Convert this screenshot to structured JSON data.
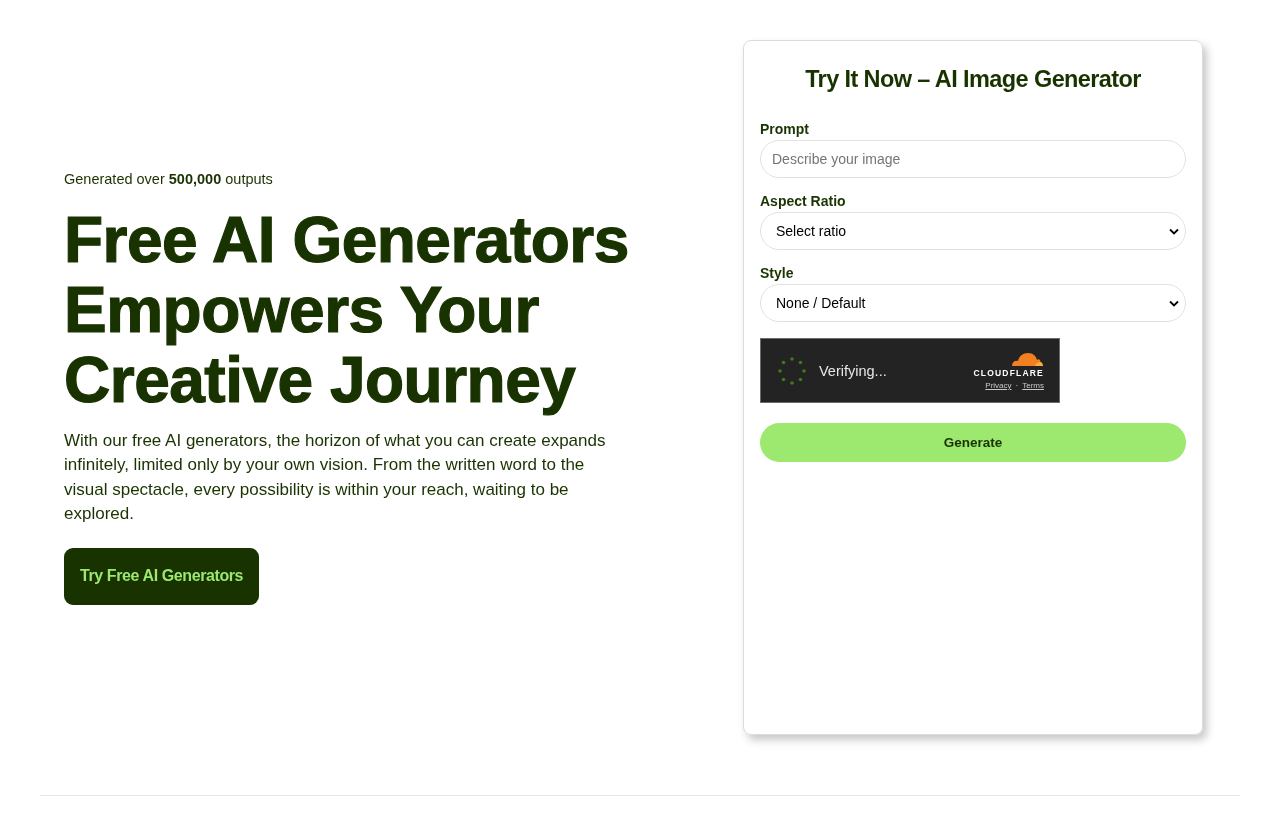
{
  "hero": {
    "stat": "Generated over **500,000** outputs",
    "headline": "Free AI Generators Empowers Your Creative Journey",
    "description": "With our free AI generators, the horizon of what you can create expands infinitely, limited only by your own vision. From the written word to the visual spectacle, every possibility is within your reach, waiting to be explored.",
    "cta": "Try Free AI Generators"
  },
  "generator_card": {
    "title": "Try It Now – AI Image Generator",
    "fields": [
      {
        "kind": "text",
        "label": "Prompt",
        "placeholder": "Describe your image"
      },
      {
        "kind": "select",
        "label": "Aspect Ratio",
        "value": "Select ratio"
      },
      {
        "kind": "select",
        "label": "Style",
        "value": "None / Default"
      }
    ],
    "captcha": {
      "status": "Verifying...",
      "brand": "CLOUDFLARE",
      "links": [
        "Privacy",
        "Terms"
      ],
      "separator": "·"
    },
    "button": "Generate"
  }
}
